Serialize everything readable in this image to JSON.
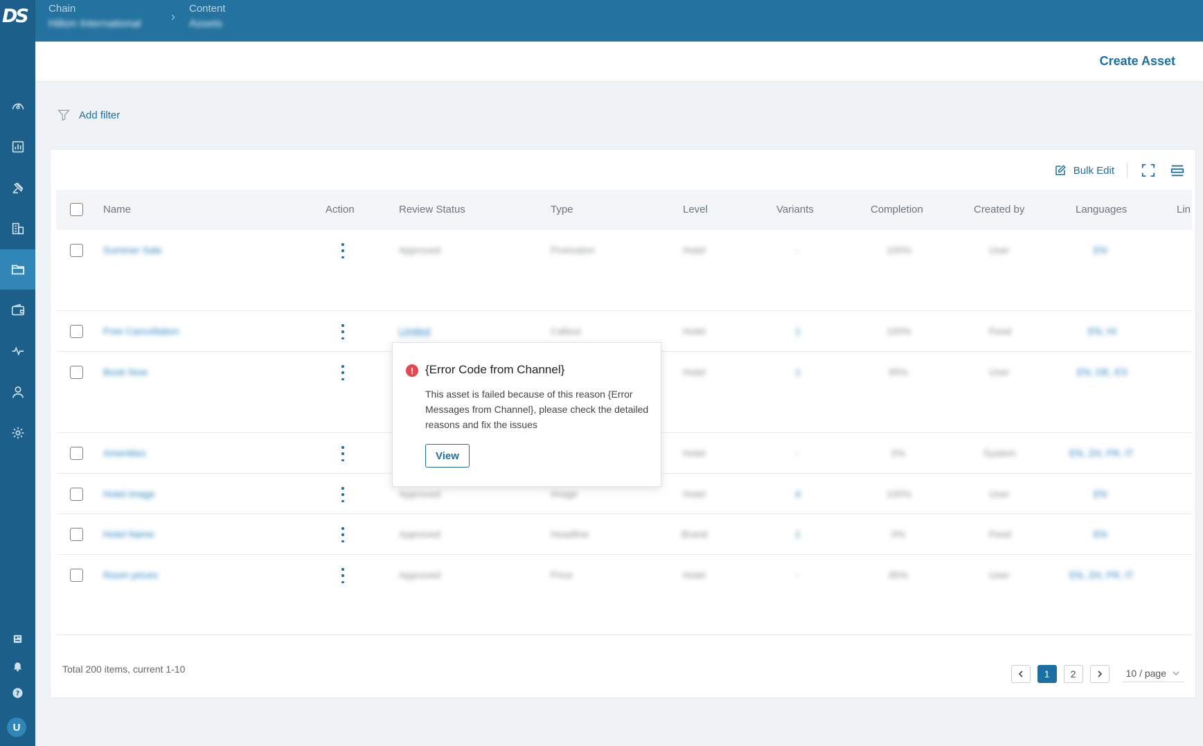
{
  "app": {
    "logo": "DS",
    "user_initial": "U"
  },
  "sidebar": {
    "items": [
      {
        "icon": "dashboard-icon"
      },
      {
        "icon": "reports-icon"
      },
      {
        "icon": "marketing-icon"
      },
      {
        "icon": "building-icon"
      },
      {
        "icon": "folder-icon",
        "active": true
      },
      {
        "icon": "wallet-icon"
      },
      {
        "icon": "activity-icon"
      },
      {
        "icon": "user-icon"
      },
      {
        "icon": "settings-icon"
      }
    ],
    "bottom": [
      {
        "icon": "news-icon"
      },
      {
        "icon": "bell-icon"
      },
      {
        "icon": "help-icon"
      }
    ]
  },
  "breadcrumb": {
    "chain_label": "Chain",
    "chain_value": "Hilton International",
    "content_label": "Content",
    "content_value": "Assets"
  },
  "header": {
    "create_label": "Create Asset"
  },
  "filter": {
    "label": "Add filter"
  },
  "toolbar": {
    "bulk_edit": "Bulk Edit"
  },
  "table": {
    "columns": [
      "Name",
      "Action",
      "Review Status",
      "Type",
      "Level",
      "Variants",
      "Completion",
      "Created by",
      "Languages",
      "Lin"
    ],
    "rows": [
      {
        "name": "Summer Sale",
        "status": "Approved",
        "type": "Promotion",
        "level": "Hotel",
        "variants": "-",
        "completion": "100%",
        "created_by": "User",
        "languages": "EN"
      },
      {
        "name": "Free Cancellation",
        "status": "Limited",
        "type": "Callout",
        "level": "Hotel",
        "variants": "1",
        "completion": "100%",
        "created_by": "Feed",
        "languages": "EN, HI"
      },
      {
        "name": "Book Now",
        "status": "",
        "type": "",
        "level": "Hotel",
        "variants": "1",
        "completion": "95%",
        "created_by": "User",
        "languages": "EN, DE, ES"
      },
      {
        "name": "Amenities",
        "status": "",
        "type": "",
        "level": "Hotel",
        "variants": "-",
        "completion": "0%",
        "created_by": "System",
        "languages": "EN, ZH, FR, IT"
      },
      {
        "name": "Hotel image",
        "status": "Approved",
        "type": "Image",
        "level": "Hotel",
        "variants": "4",
        "completion": "100%",
        "created_by": "User",
        "languages": "EN"
      },
      {
        "name": "Hotel Name",
        "status": "Approved",
        "type": "Headline",
        "level": "Brand",
        "variants": "1",
        "completion": "0%",
        "created_by": "Feed",
        "languages": "EN"
      },
      {
        "name": "Room prices",
        "status": "Approved",
        "type": "Price",
        "level": "Hotel",
        "variants": "-",
        "completion": "95%",
        "created_by": "User",
        "languages": "EN, ZH, FR, IT"
      }
    ]
  },
  "footer": {
    "total": "Total 200 items, current 1-10",
    "pages": [
      "1",
      "2"
    ],
    "page_size": "10 / page"
  },
  "popover": {
    "title": "{Error Code from Channel}",
    "body": "This asset is failed because of this reason {Error Messages from Channel}, please check the detailed reasons and fix the issues",
    "button": "View"
  },
  "colors": {
    "sidebar": "#1b5f8a",
    "topbar": "#23729f",
    "accent": "#1c6fa3",
    "error": "#e5484d"
  }
}
